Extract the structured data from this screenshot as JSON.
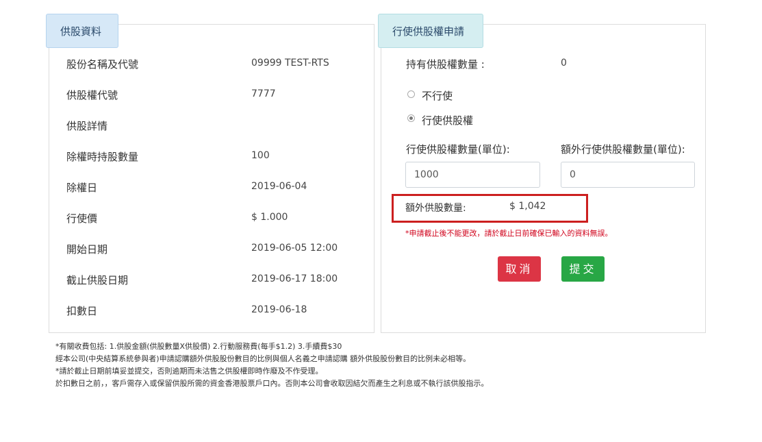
{
  "left": {
    "tab": "供股資料",
    "rows": [
      {
        "label": "股份名稱及代號",
        "value": "09999 TEST-RTS"
      },
      {
        "label": "供股權代號",
        "value": "7777"
      },
      {
        "label": "供股詳情",
        "value": ""
      },
      {
        "label": "除權時持股數量",
        "value": "100"
      },
      {
        "label": "除權日",
        "value": "2019-06-04"
      },
      {
        "label": "行使價",
        "value": "$ 1.000"
      },
      {
        "label": "開始日期",
        "value": "2019-06-05 12:00"
      },
      {
        "label": "截止供股日期",
        "value": "2019-06-17 18:00"
      },
      {
        "label": "扣數日",
        "value": "2019-06-18"
      }
    ]
  },
  "right": {
    "tab": "行使供股權申請",
    "holding_label": "持有供股權數量 :",
    "holding_value": "0",
    "option_no": "不行使",
    "option_yes": "行使供股權",
    "exercise_label": "行使供股權數量(單位):",
    "exercise_value": "1000",
    "extra_label": "額外行使供股權數量(單位):",
    "extra_value": "0",
    "extra_shares_label": "額外供股數量:",
    "extra_shares_value": "$ 1,042",
    "warning": "*申請截止後不能更改，請於截止日前確保已輸入的資料無誤。",
    "cancel": "取消",
    "submit": "提交"
  },
  "notes": [
    "*有關收費包括: 1.供股金額(供股數量X供股價) 2.行動服務費(每手$1.2) 3.手續費$30",
    "經本公司(中央結算系統參與者)申請認購額外供股股份數目的比例與個人名義之申請認購 額外供股股份數目的比例未必相等。",
    "*請於截止日期前填妥並提交，否則逾期而未沽售之供股權即時作廢及不作受理。",
    "於扣數日之前，，客戶需存入或保留供股所需的資金香港股票戶口內。否則本公司會收取因結欠而產生之利息或不執行該供股指示。"
  ]
}
